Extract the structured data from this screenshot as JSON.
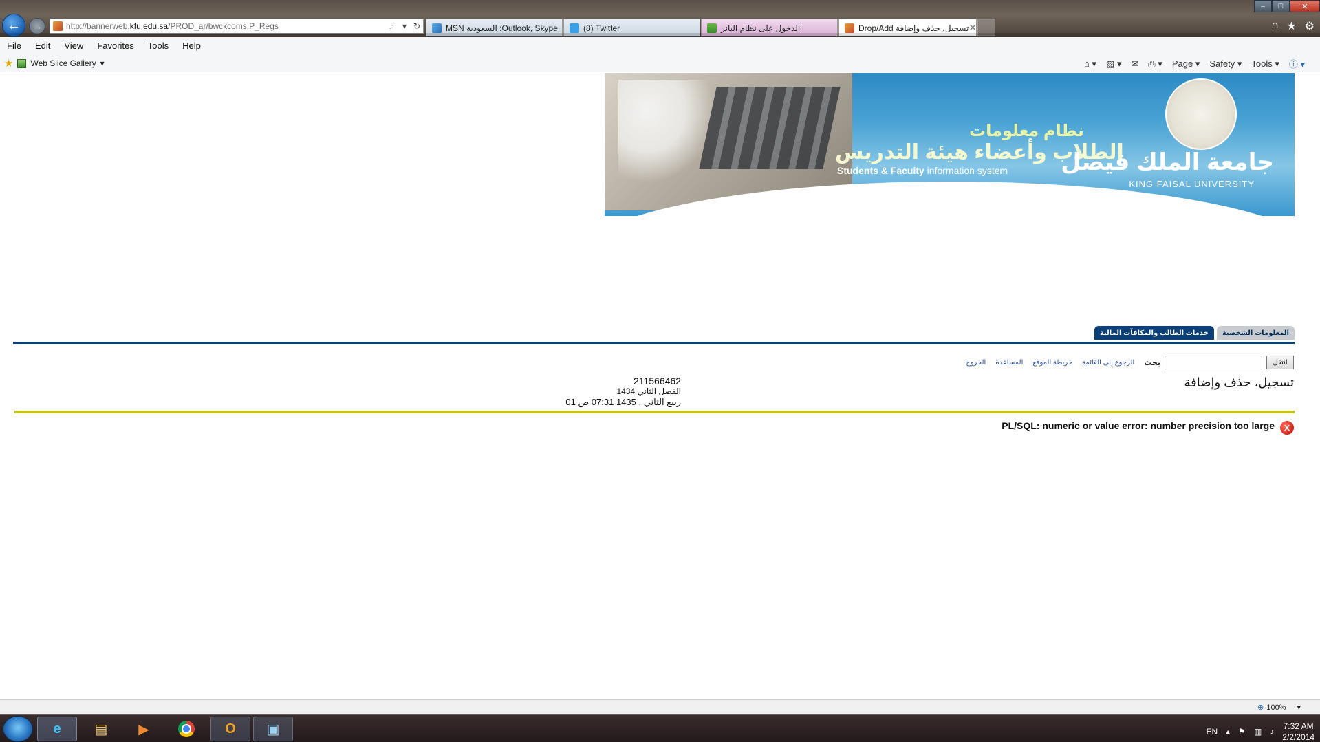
{
  "browser": {
    "url_prefix": "http://bannerweb.",
    "url_domain": "kfu.edu.sa",
    "url_path": "/PROD_ar/bwckcoms.P_Regs",
    "tabs": [
      {
        "label": "MSN السعودية :Outlook, Skype, ..."
      },
      {
        "label": "(8) Twitter"
      },
      {
        "label": "الدخول على نظام البانر"
      },
      {
        "label": "Drop/Add تسجيل، حذف وإضافة"
      }
    ],
    "menu": [
      "File",
      "Edit",
      "View",
      "Favorites",
      "Tools",
      "Help"
    ],
    "web_slice": "Web Slice Gallery",
    "commands": {
      "page": "Page",
      "safety": "Safety",
      "tools": "Tools"
    },
    "zoom": "100%"
  },
  "banner": {
    "title_ar_line1": "نظام معلومات",
    "title_ar_line2": "الطلاب وأعضاء هيئة التدريس",
    "title_en_bold": "Students & Faculty",
    "title_en_rest": " information system",
    "univ_ar": "جامعة الملك فيصل",
    "univ_en": "KING FAISAL UNIVERSITY"
  },
  "page_tabs": [
    {
      "label": "المعلومات الشخصية",
      "active": false
    },
    {
      "label": "خدمات الطالب والمكافآت المالية",
      "active": true
    }
  ],
  "toolbar": {
    "go_label": "انتقل",
    "search_label": "بحث",
    "links": [
      "الرجوع إلى القائمة",
      "خريطة الموقع",
      "المساعدة",
      "الخروج"
    ]
  },
  "page": {
    "title": "تسجيل، حذف وإضافة",
    "student_id": "211566462",
    "term": "الفصل الثاني 1434",
    "datetime": "01 ربيع الثاني , 1435 07:31 ص",
    "error_icon": "X",
    "error_message": "PL/SQL: numeric or value error: number precision too large"
  },
  "taskbar": {
    "language": "EN",
    "time": "7:32 AM",
    "date": "2/2/2014"
  }
}
